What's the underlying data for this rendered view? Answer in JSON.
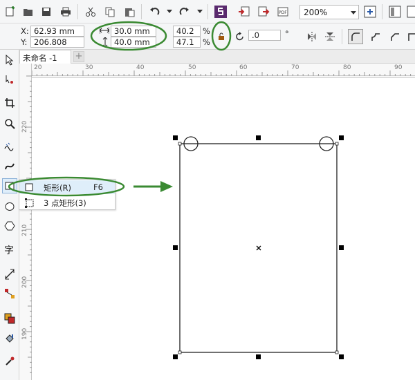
{
  "toolbar": {
    "zoom": "200%"
  },
  "propbar": {
    "x_label": "X:",
    "x_value": "62.93 mm",
    "y_label": "Y:",
    "y_value": "206.808 mm",
    "width_value": "30.0 mm",
    "height_value": "40.0 mm",
    "scale_w": "40.2",
    "scale_h": "47.1",
    "percent": "%",
    "rotation": ".0",
    "degree": "°"
  },
  "tabs": {
    "doc_name": "未命名 -1",
    "add": "+"
  },
  "ruler": {
    "h_ticks": [
      "20",
      "30",
      "40",
      "50",
      "60",
      "70",
      "80",
      "90"
    ],
    "v_ticks": [
      "220",
      "210",
      "200",
      "190"
    ]
  },
  "flyout": {
    "items": [
      {
        "label": "矩形(R)",
        "shortcut": "F6"
      },
      {
        "label": "3 点矩形(3)",
        "shortcut": ""
      }
    ]
  },
  "colors": {
    "highlight_green": "#3a8a32",
    "selection": "#dfeefa"
  }
}
